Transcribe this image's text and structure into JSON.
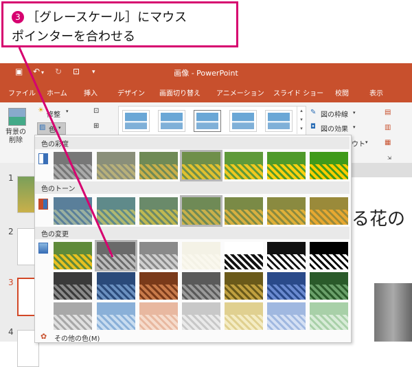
{
  "callout": {
    "step": "3",
    "line1": "［グレースケール］にマウス",
    "line2": "ポインターを合わせる"
  },
  "window": {
    "title": "画像 - PowerPoint"
  },
  "tabs": [
    "ファイル",
    "ホーム",
    "挿入",
    "デザイン",
    "画面切り替え",
    "アニメーション",
    "スライド ショー",
    "校閲",
    "表示"
  ],
  "ribbon": {
    "remove_bg": "背景の\n削除",
    "corrections": "修整",
    "color": "色",
    "picture_border": "図の枠線",
    "picture_effects": "図の効果",
    "layout_partial": "ウト"
  },
  "panel": {
    "sections": [
      "色の彩度",
      "色のトーン",
      "色の変更"
    ],
    "more_colors": "その他の色(M)"
  },
  "slides": {
    "numbers": [
      "1",
      "2",
      "3",
      "4"
    ],
    "current": "3"
  },
  "slide_preview_text": "る花の",
  "colors": {
    "accent": "#c8502d",
    "callout": "#d6006f"
  }
}
